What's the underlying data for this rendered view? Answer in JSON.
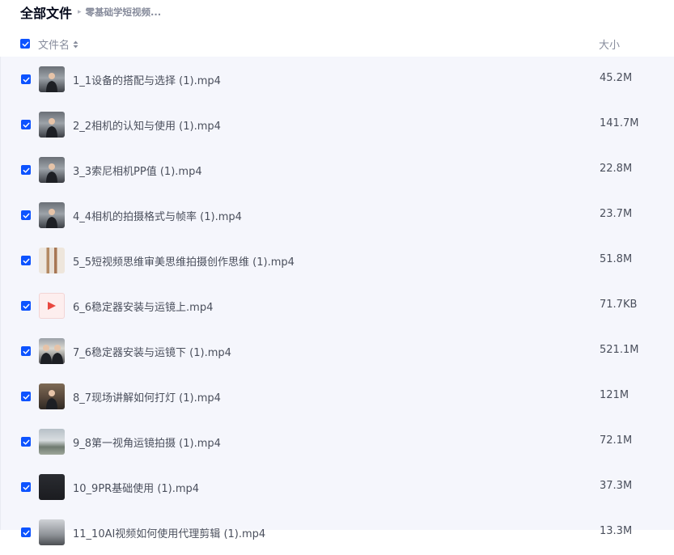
{
  "breadcrumb": {
    "root": "全部文件",
    "separator": "▸",
    "current": "零基础学短视频..."
  },
  "header": {
    "name_label": "文件名",
    "size_label": "大小",
    "select_all_checked": true
  },
  "files": [
    {
      "name": "1_1设备的搭配与选择 (1).mp4",
      "size": "45.2M",
      "thumb": "person",
      "checked": true
    },
    {
      "name": "2_2相机的认知与使用 (1).mp4",
      "size": "141.7M",
      "thumb": "person",
      "checked": true
    },
    {
      "name": "3_3索尼相机PP值 (1).mp4",
      "size": "22.8M",
      "thumb": "person",
      "checked": true
    },
    {
      "name": "4_4相机的拍摄格式与帧率 (1).mp4",
      "size": "23.7M",
      "thumb": "person",
      "checked": true
    },
    {
      "name": "5_5短视频思维审美思维拍摄创作思维 (1).mp4",
      "size": "51.8M",
      "thumb": "collage",
      "checked": true
    },
    {
      "name": "6_6稳定器安装与运镜上.mp4",
      "size": "71.7KB",
      "thumb": "video-play-icon",
      "checked": true
    },
    {
      "name": "7_6稳定器安装与运镜下 (1).mp4",
      "size": "521.1M",
      "thumb": "two",
      "checked": true
    },
    {
      "name": "8_7现场讲解如何打灯 (1).mp4",
      "size": "121M",
      "thumb": "stage",
      "checked": true
    },
    {
      "name": "9_8第一视角运镜拍摄 (1).mp4",
      "size": "72.1M",
      "thumb": "outdoor",
      "checked": true
    },
    {
      "name": "10_9PR基础使用 (1).mp4",
      "size": "37.3M",
      "thumb": "dark",
      "checked": true
    },
    {
      "name": "11_10AI视频如何使用代理剪辑 (1).mp4",
      "size": "13.3M",
      "thumb": "dark2",
      "checked": true
    }
  ],
  "colors": {
    "accent": "#0d53ff",
    "list_bg": "#f5f6fc",
    "muted_text": "#878c9c",
    "play_red": "#e8473f"
  }
}
